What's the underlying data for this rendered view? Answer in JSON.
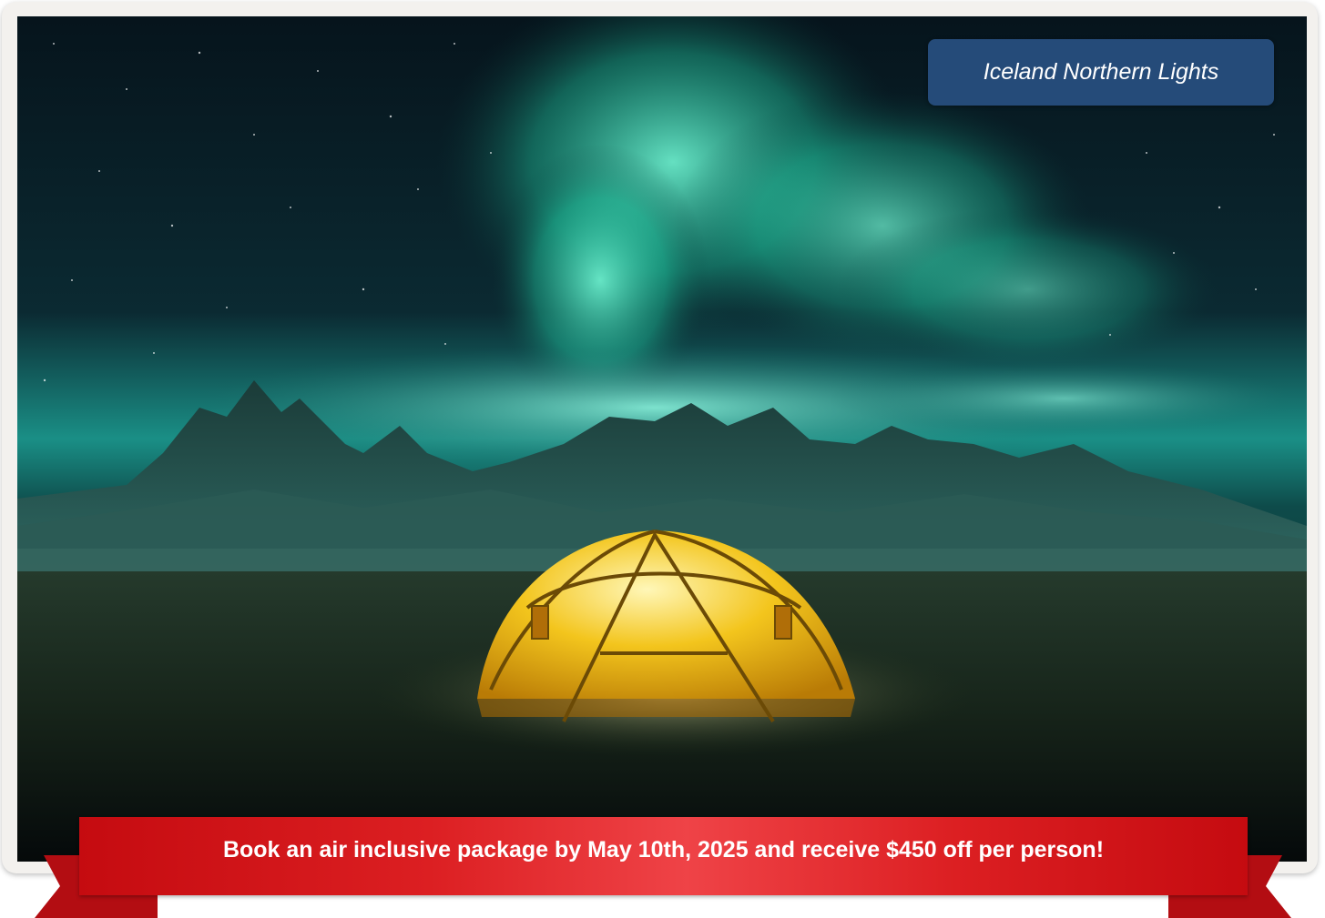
{
  "promo": {
    "destination": "Iceland Northern Lights",
    "offer": "Book an air inclusive package by May 10th, 2025 and receive $450 off per person!",
    "image_subject": "aurora-tent-mountains",
    "colors": {
      "tag_bg": "#254b79",
      "ribbon_red": "#d71a1f",
      "card_bg": "#f3f1ee"
    }
  }
}
